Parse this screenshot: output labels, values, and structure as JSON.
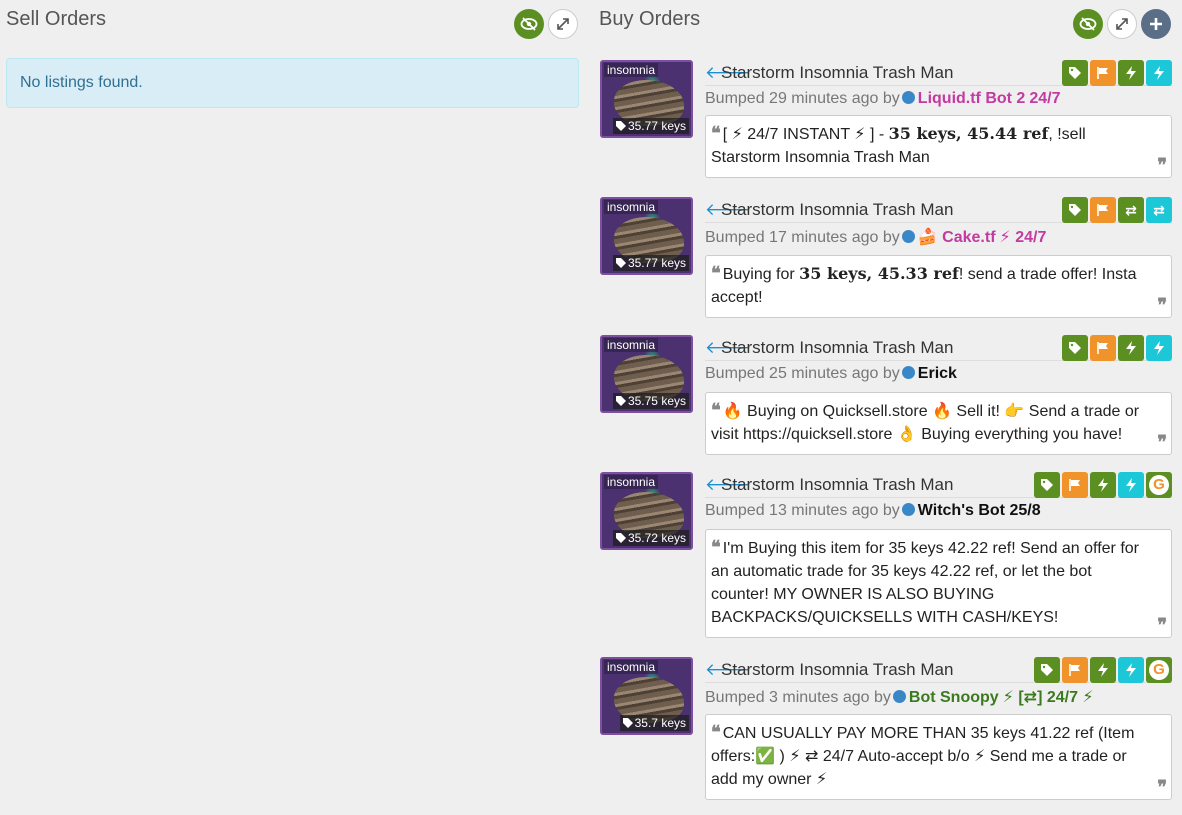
{
  "sell": {
    "title": "Sell Orders",
    "empty_text": "No listings found."
  },
  "buy": {
    "title": "Buy Orders",
    "listings": [
      {
        "thumb_label": "insomnia",
        "price": "35.77 keys",
        "name": "Starstorm Insomnia Trash Man",
        "bumped": "Bumped 29 minutes ago by",
        "user": "Liquid.tf Bot 2",
        "user_color": "#c33aa0",
        "extra": "24/7",
        "extra_color": "#c33aa0",
        "badges": [
          "tag",
          "flag",
          "bolt",
          "bolt"
        ],
        "comment_parts": [
          "[ ⚡ 24/7 INSTANT ⚡ ] - ",
          "35 keys, 45.44 ref",
          ", !sell Starstorm Insomnia Trash Man"
        ]
      },
      {
        "thumb_label": "insomnia",
        "price": "35.77 keys",
        "name": "Starstorm Insomnia Trash Man",
        "bumped": "Bumped 17 minutes ago by",
        "user": "🍰 Cake.tf",
        "user_color": "#c33aa0",
        "extra": "⚡ 24/7",
        "extra_color": "#c33aa0",
        "badges": [
          "tag",
          "flag",
          "swap",
          "swap"
        ],
        "comment_parts": [
          "Buying for ",
          "35 keys, 45.33 ref",
          "! send a trade offer! Insta accept!"
        ]
      },
      {
        "thumb_label": "insomnia",
        "price": "35.75 keys",
        "name": "Starstorm Insomnia Trash Man",
        "bumped": "Bumped 25 minutes ago by",
        "user": "Erick",
        "user_color": "#111111",
        "extra": "",
        "extra_color": "#111111",
        "badges": [
          "tag",
          "flag",
          "bolt",
          "bolt"
        ],
        "comment_parts": [
          "🔥 Buying on Quicksell.store 🔥  Sell it! 👉 Send a trade or visit https://quicksell.store 👌  Buying everything you have!",
          "",
          ""
        ]
      },
      {
        "thumb_label": "insomnia",
        "price": "35.72 keys",
        "name": "Starstorm Insomnia Trash Man",
        "bumped": "Bumped 13 minutes ago by",
        "user": "Witch's Bot 25/8",
        "user_color": "#111111",
        "extra": "",
        "extra_color": "#111111",
        "badges": [
          "tag",
          "flag",
          "bolt",
          "bolt",
          "g"
        ],
        "comment_parts": [
          "I'm Buying this item for 35 keys 42.22 ref! Send an offer for an automatic trade for 35 keys 42.22 ref, or let the bot counter! MY OWNER IS ALSO BUYING BACKPACKS/QUICKSELLS WITH CASH/KEYS!",
          "",
          ""
        ]
      },
      {
        "thumb_label": "insomnia",
        "price": "35.7 keys",
        "name": "Starstorm Insomnia Trash Man",
        "bumped": "Bumped 3 minutes ago by",
        "user": "Bot Snoopy",
        "user_color": "#3b7a1e",
        "extra": "⚡ [⇄] 24/7 ⚡",
        "extra_color": "#3b7a1e",
        "badges": [
          "tag",
          "flag",
          "bolt",
          "bolt",
          "g"
        ],
        "comment_parts": [
          "CAN USUALLY PAY MORE THAN 35 keys 41.22 ref (Item offers:✅ ) ⚡ ⇄ 24/7 Auto-accept b/o ⚡ Send me a trade or add my owner ⚡",
          "",
          ""
        ]
      }
    ]
  },
  "colors": {
    "green": "#5b8f22",
    "orange": "#f0932b",
    "cyan": "#1cc8d8",
    "alert_bg": "#d9edf7",
    "alert_text": "#31708f"
  }
}
